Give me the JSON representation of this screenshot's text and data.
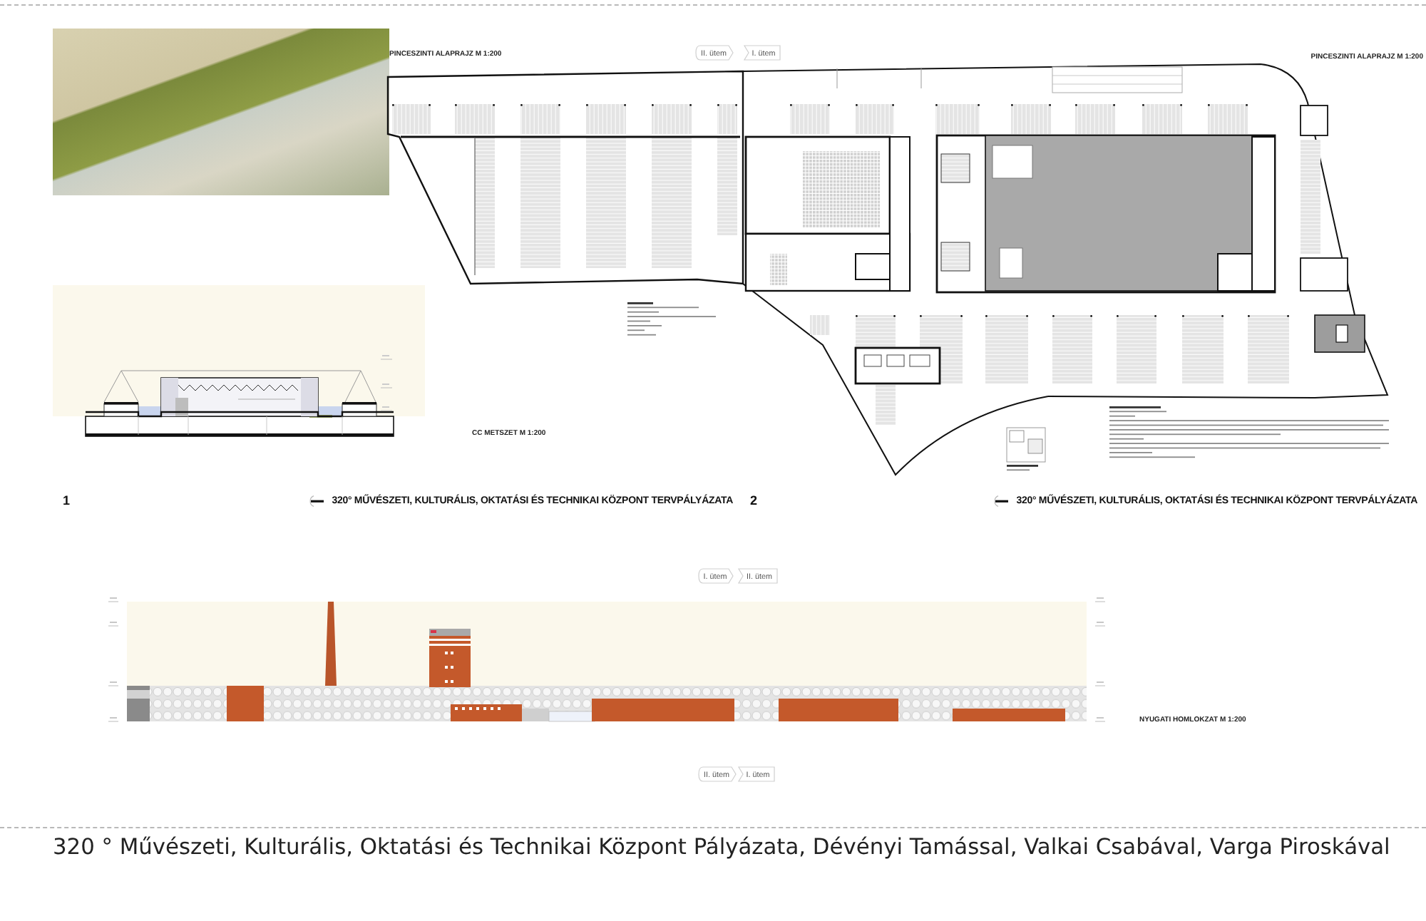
{
  "plan": {
    "title_left": "PINCESZINTI ALAPRAJZ M 1:200",
    "phase_tags": [
      {
        "label": "II. ütem"
      },
      {
        "label": "I. ütem"
      }
    ],
    "title_right": "PINCESZINTI ALAPRAJZ M 1:200"
  },
  "section": {
    "caption": "CC METSZET M 1:200"
  },
  "title_bar": [
    {
      "number": "1",
      "title": "320° MŰVÉSZETI, KULTURÁLIS, OKTATÁSI ÉS TECHNIKAI KÖZPONT TERVPÁLYÁZATA"
    },
    {
      "number": "2",
      "title": "320° MŰVÉSZETI, KULTURÁLIS, OKTATÁSI ÉS TECHNIKAI KÖZPONT TERVPÁLYÁZATA"
    }
  ],
  "elevation": {
    "phase_tags_top": [
      {
        "label": "I. ütem"
      },
      {
        "label": "II. ütem"
      }
    ],
    "caption": "NYUGATI HOMLOKZAT M 1:200",
    "phase_tags_bottom": [
      {
        "label": "II. ütem"
      },
      {
        "label": "I. ütem"
      }
    ]
  },
  "caption": "320 ° Művészeti, Kulturális, Oktatási és Technikai Központ Pályázata, Dévényi Tamással, Valkai Csabával, Varga Piroskával"
}
